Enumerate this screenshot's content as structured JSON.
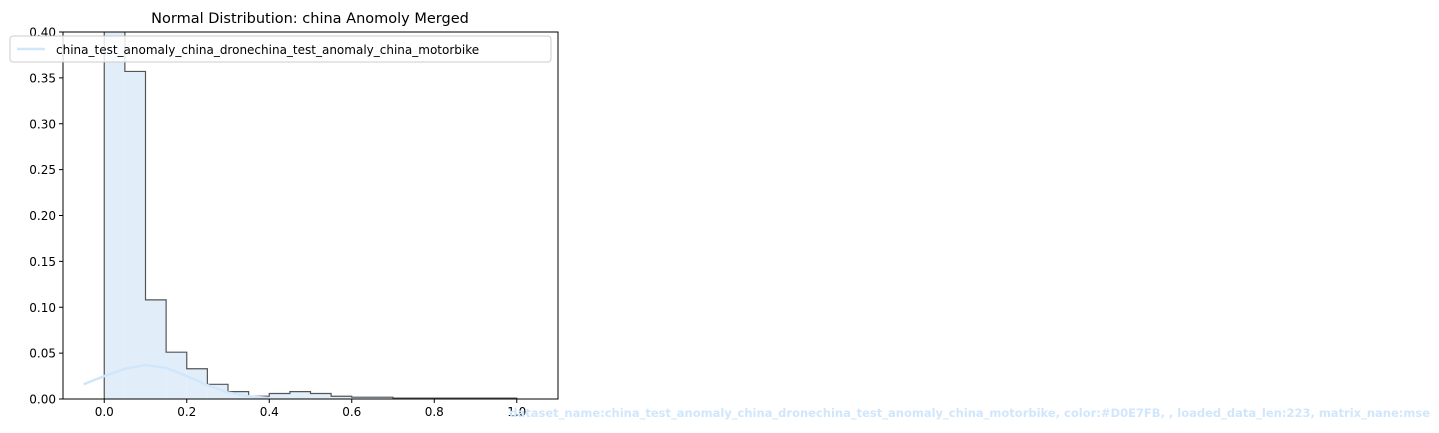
{
  "chart_data": {
    "type": "bar",
    "title": "Normal Distribution: china Anomoly Merged",
    "xlabel": "",
    "ylabel": "",
    "xlim": [
      -0.1,
      1.1
    ],
    "ylim": [
      0,
      0.4
    ],
    "xticks": [
      0.0,
      0.2,
      0.4,
      0.6,
      0.8,
      1.0
    ],
    "yticks": [
      0.0,
      0.05,
      0.1,
      0.15,
      0.2,
      0.25,
      0.3,
      0.35,
      0.4
    ],
    "xtick_labels": [
      "0.0",
      "0.2",
      "0.4",
      "0.6",
      "0.8",
      "1.0"
    ],
    "ytick_labels": [
      "0.00",
      "0.05",
      "0.10",
      "0.15",
      "0.20",
      "0.25",
      "0.30",
      "0.35",
      "0.40"
    ],
    "grid": false,
    "legend_position": "top-left",
    "bin_edges": [
      0.0,
      0.05,
      0.1,
      0.15,
      0.2,
      0.25,
      0.3,
      0.35,
      0.4,
      0.45,
      0.5,
      0.55,
      0.6,
      0.65,
      0.7,
      0.75,
      0.8,
      0.85,
      0.9,
      0.95,
      1.0
    ],
    "series": [
      {
        "name": "china_test_anomaly_china_dronechina_test_anomaly_china_motorbike",
        "kind": "histogram",
        "values": [
          0.43,
          0.357,
          0.108,
          0.051,
          0.033,
          0.016,
          0.008,
          0.003,
          0.006,
          0.008,
          0.006,
          0.003,
          0.002,
          0.002,
          0.001,
          0.001,
          0.001,
          0.001,
          0.001,
          0.001
        ],
        "fill_color": "#e1eefa",
        "edge_color": "#555555"
      },
      {
        "name": "china_test_anomaly_china_dronechina_test_anomaly_china_motorbike",
        "kind": "line",
        "x": [
          -0.05,
          0.0,
          0.05,
          0.1,
          0.15,
          0.2,
          0.25,
          0.3,
          0.35,
          0.4
        ],
        "y": [
          0.016,
          0.025,
          0.033,
          0.037,
          0.034,
          0.025,
          0.015,
          0.007,
          0.003,
          0.001
        ],
        "color": "#D0E7FB"
      }
    ],
    "annotation": "dataset_name:china_test_anomaly_china_dronechina_test_anomaly_china_motorbike, color:#D0E7FB, , loaded_data_len:223, matrix_nane:mse",
    "annotation_color": "#D0E7FB"
  }
}
